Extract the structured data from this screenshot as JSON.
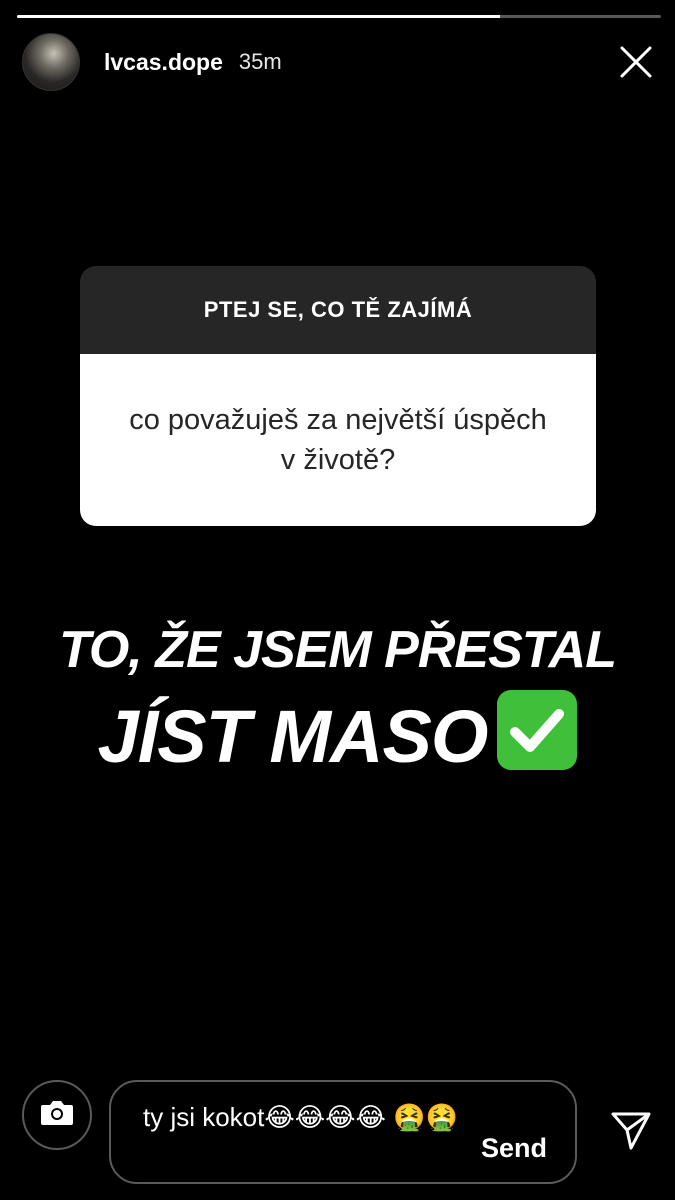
{
  "story": {
    "username": "lvcas.dope",
    "time_ago": "35m",
    "progress": {
      "segments": 1,
      "current_fill": 0.75
    }
  },
  "question_sticker": {
    "title": "PTEJ SE, CO TĚ ZAJÍMÁ",
    "question": "co považuješ za největší úspěch v životě?"
  },
  "answer": {
    "line1": "TO, ŽE JSEM PŘESTAL",
    "line2": "JÍST MASO",
    "emoji": "check-mark-button-emoji"
  },
  "reply": {
    "text": "ty jsi kokot😂😂😂😂 🤮🤮",
    "send_label": "Send"
  },
  "icons": {
    "close": "close-icon",
    "camera": "camera-icon",
    "direct": "paper-plane-icon"
  },
  "colors": {
    "background": "#000000",
    "sticker_header": "#262626",
    "sticker_body": "#ffffff",
    "check_green": "#3fbf3a"
  }
}
